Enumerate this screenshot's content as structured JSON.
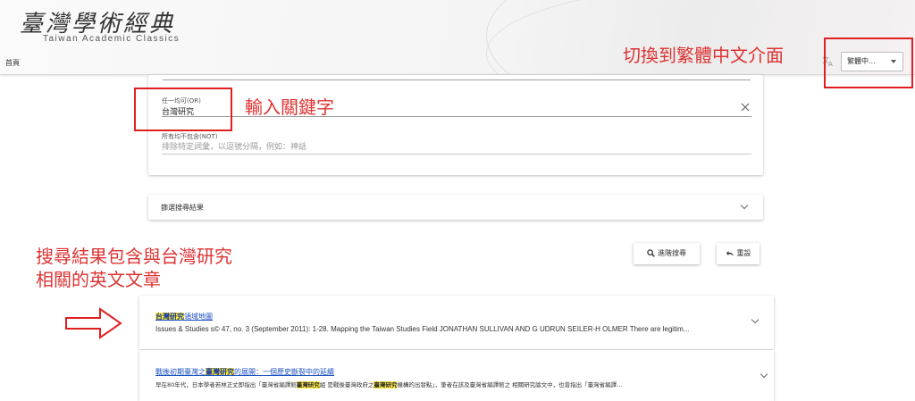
{
  "header": {
    "logo_main": "臺灣學術經典",
    "logo_sub": "Taiwan Academic Classics",
    "home_link": "首頁",
    "language_select": "繁體中...",
    "annotation_language": "切換到繁體中文介面"
  },
  "search": {
    "or_label": "任一均可(OR)",
    "or_value": "台灣研究",
    "not_label": "所有均不包含(NOT)",
    "not_placeholder": "排除特定詞彙，以逗號分隔，例如：神話",
    "annotation_keyword": "輸入關鍵字"
  },
  "filter": {
    "label": "篩選搜尋結果"
  },
  "buttons": {
    "advanced": "進階搜尋",
    "reset": "重設"
  },
  "annotation_results": {
    "line1": "搜尋結果包含與台灣研究",
    "line2": "相關的英文文章"
  },
  "results": [
    {
      "title_highlight": "台灣研究",
      "title_rest": "領域地圖",
      "snippet": "Issues & Studies s© 47, no. 3 (September 2011): 1-28. Mapping the Taiwan Studies Field JONATHAN SULLIVAN AND G UDRUN SEILER-H OLMER There are legitim..."
    },
    {
      "title_pre": "戰後初期臺灣之",
      "title_highlight": "臺灣研究",
      "title_rest": "的展開：一個歷史斷裂中的延續",
      "snippet_a": "早在80年代，日本學者若林正丈即指出「臺灣省編譯館",
      "snippet_hl1": "臺灣研究",
      "snippet_b": "組 是戰後臺灣政府之",
      "snippet_hl2": "臺灣研究",
      "snippet_c": "機構的出發點」，筆者在該及臺灣省編譯館之 相關研究論文中，也曾指出「臺灣省編譯..."
    }
  ]
}
